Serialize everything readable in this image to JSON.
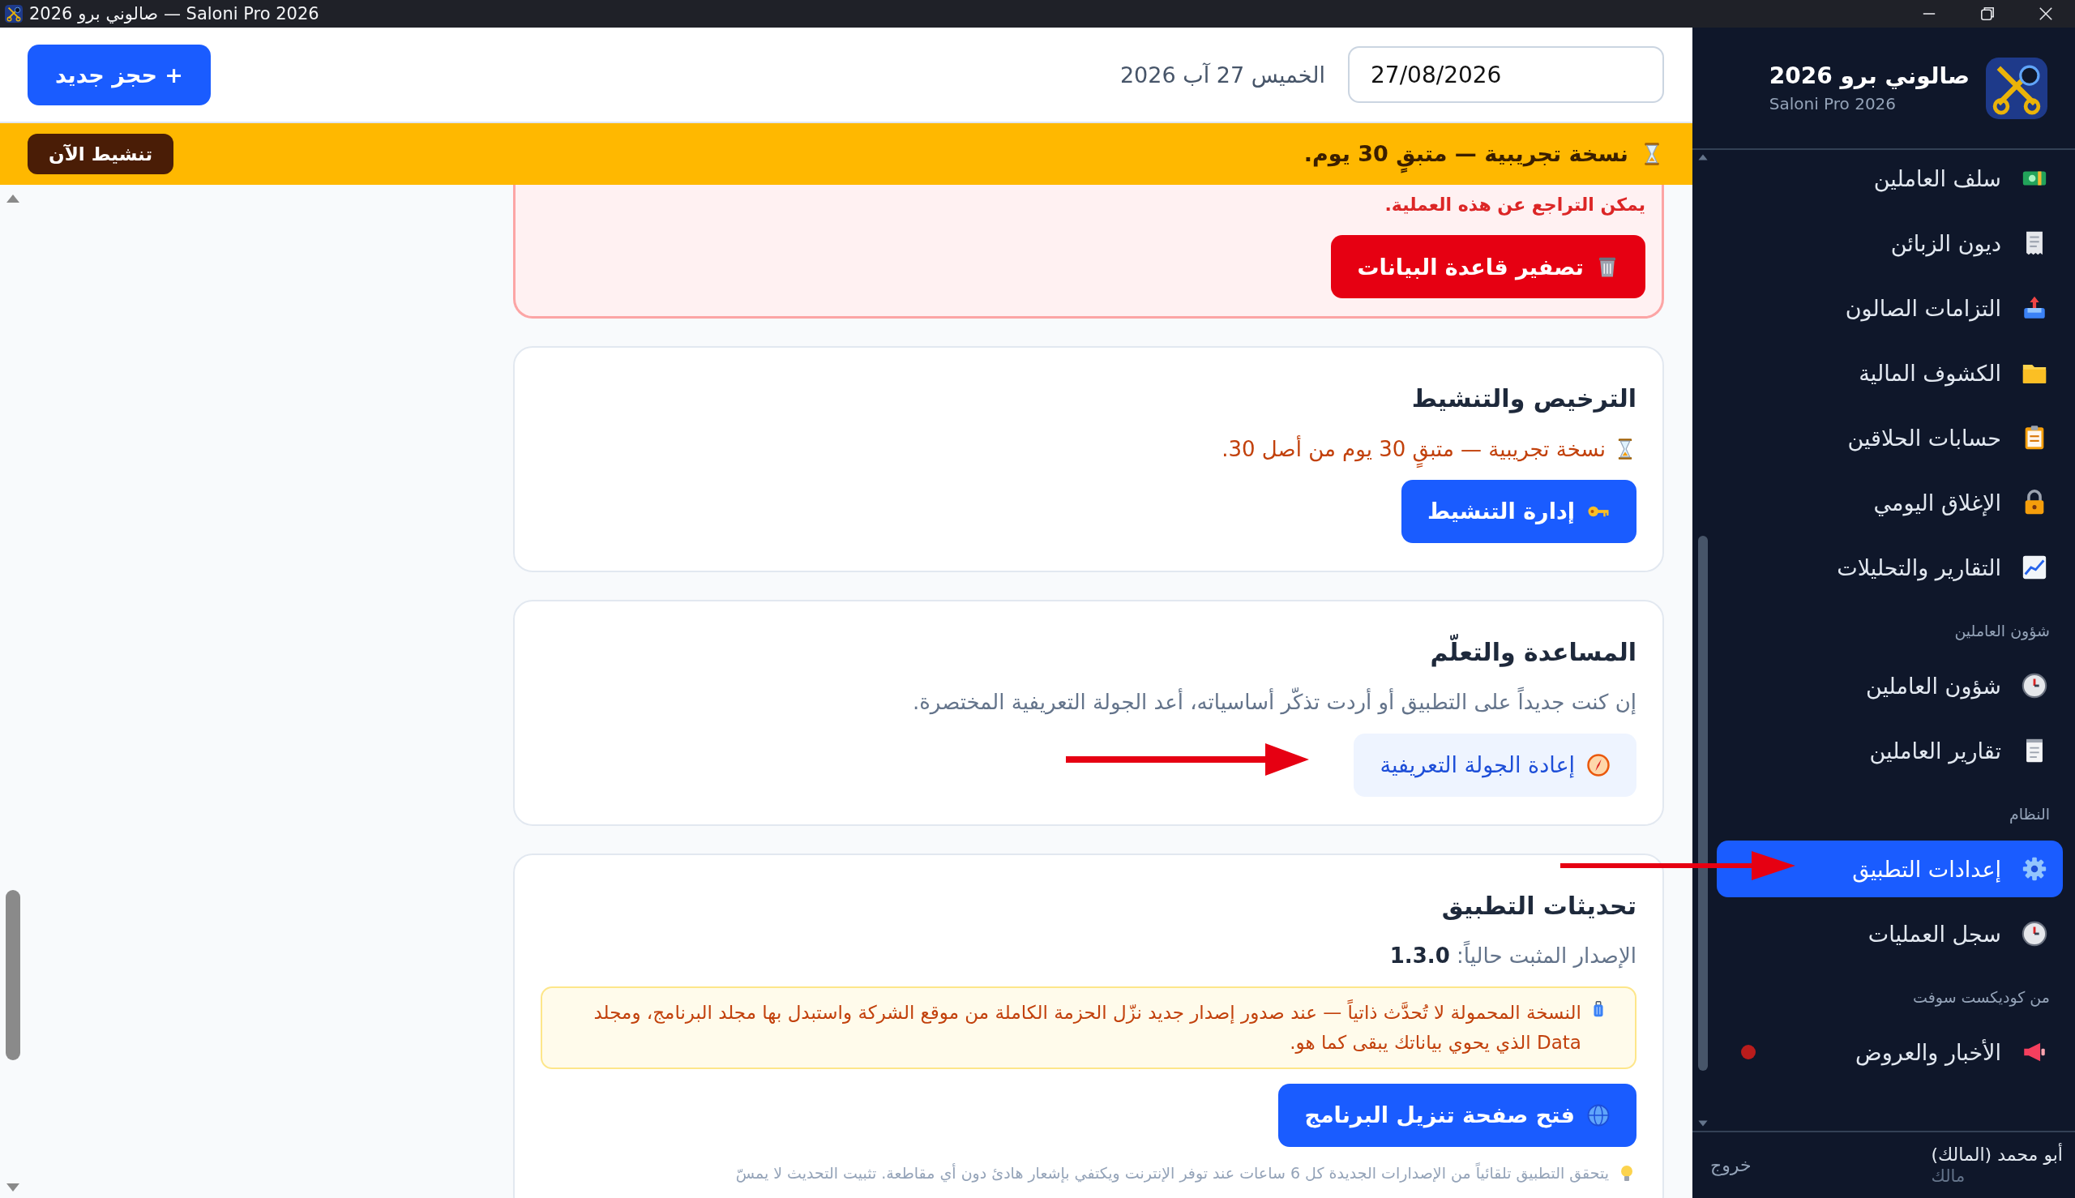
{
  "title_bar": {
    "title": "صالوني برو 2026 — Saloni Pro 2026"
  },
  "header": {
    "new_booking_button": "+ حجز جديد",
    "date_label": "الخميس 27 آب 2026",
    "date_field": "27/08/2026"
  },
  "trial_banner": {
    "text": "نسخة تجريبية — متبقٍ 30 يوم.",
    "button": "تنشيط الآن"
  },
  "danger_card": {
    "note": "يمكن التراجع عن هذه العملية.",
    "button": "تصفير قاعدة البيانات"
  },
  "license_card": {
    "title": "الترخيص والتنشيط",
    "status": "نسخة تجريبية — متبقٍ 30 يوم من أصل 30.",
    "button": "إدارة التنشيط"
  },
  "help_card": {
    "title": "المساعدة والتعلّم",
    "text": "إن كنت جديداً على التطبيق أو أردت تذكّر أساسياته، أعد الجولة التعريفية المختصرة.",
    "button": "إعادة الجولة التعريفية"
  },
  "updates_card": {
    "title": "تحديثات التطبيق",
    "version": "الإصدار المثبت حالياً: **1.3.0**",
    "notice": "النسخة المحمولة لا تُحدَّث ذاتياً — عند صدور إصدار جديد نزّل الحزمة الكاملة من موقع الشركة واستبدل بها مجلد البرنامج، ومجلد Data الذي يحوي بياناتك يبقى كما هو.",
    "button": "فتح صفحة تنزيل البرنامج",
    "footnote": "يتحقق التطبيق تلقائياً من الإصدارات الجديدة كل 6 ساعات عند توفر الإنترنت ويكتفي بإشعار هادئ دون أي مقاطعة. تثبيت التحديث لا يمسّ"
  },
  "sidebar": {
    "app_name": "صالوني برو 2026",
    "app_subtitle": "Saloni Pro 2026",
    "sections": [
      {
        "items": [
          {
            "label": "سلف العاملين",
            "selected": false,
            "unread": false
          },
          {
            "label": "ديون الزبائن",
            "selected": false,
            "unread": false
          },
          {
            "label": "التزامات الصالون",
            "selected": false,
            "unread": false
          },
          {
            "label": "الكشوف المالية",
            "selected": false,
            "unread": false
          },
          {
            "label": "حسابات الحلاقين",
            "selected": false,
            "unread": false
          },
          {
            "label": "الإغلاق اليومي",
            "selected": false,
            "unread": false
          },
          {
            "label": "التقارير والتحليلات",
            "selected": false,
            "unread": false
          }
        ]
      },
      {
        "heading": "شؤون العاملين",
        "items": [
          {
            "label": "شؤون العاملين",
            "selected": false,
            "unread": false
          },
          {
            "label": "تقارير العاملين",
            "selected": false,
            "unread": false
          }
        ]
      },
      {
        "heading": "النظام",
        "items": [
          {
            "label": "إعدادات التطبيق",
            "selected": true,
            "unread": false
          },
          {
            "label": "سجل العمليات",
            "selected": false,
            "unread": false
          }
        ]
      },
      {
        "heading": "من كوديكست سوفت",
        "items": [
          {
            "label": "الأخبار والعروض",
            "selected": false,
            "unread": true
          }
        ]
      }
    ],
    "user": {
      "name": "أبو محمد (المالك)",
      "role": "مالك"
    },
    "logout": "خروج"
  }
}
